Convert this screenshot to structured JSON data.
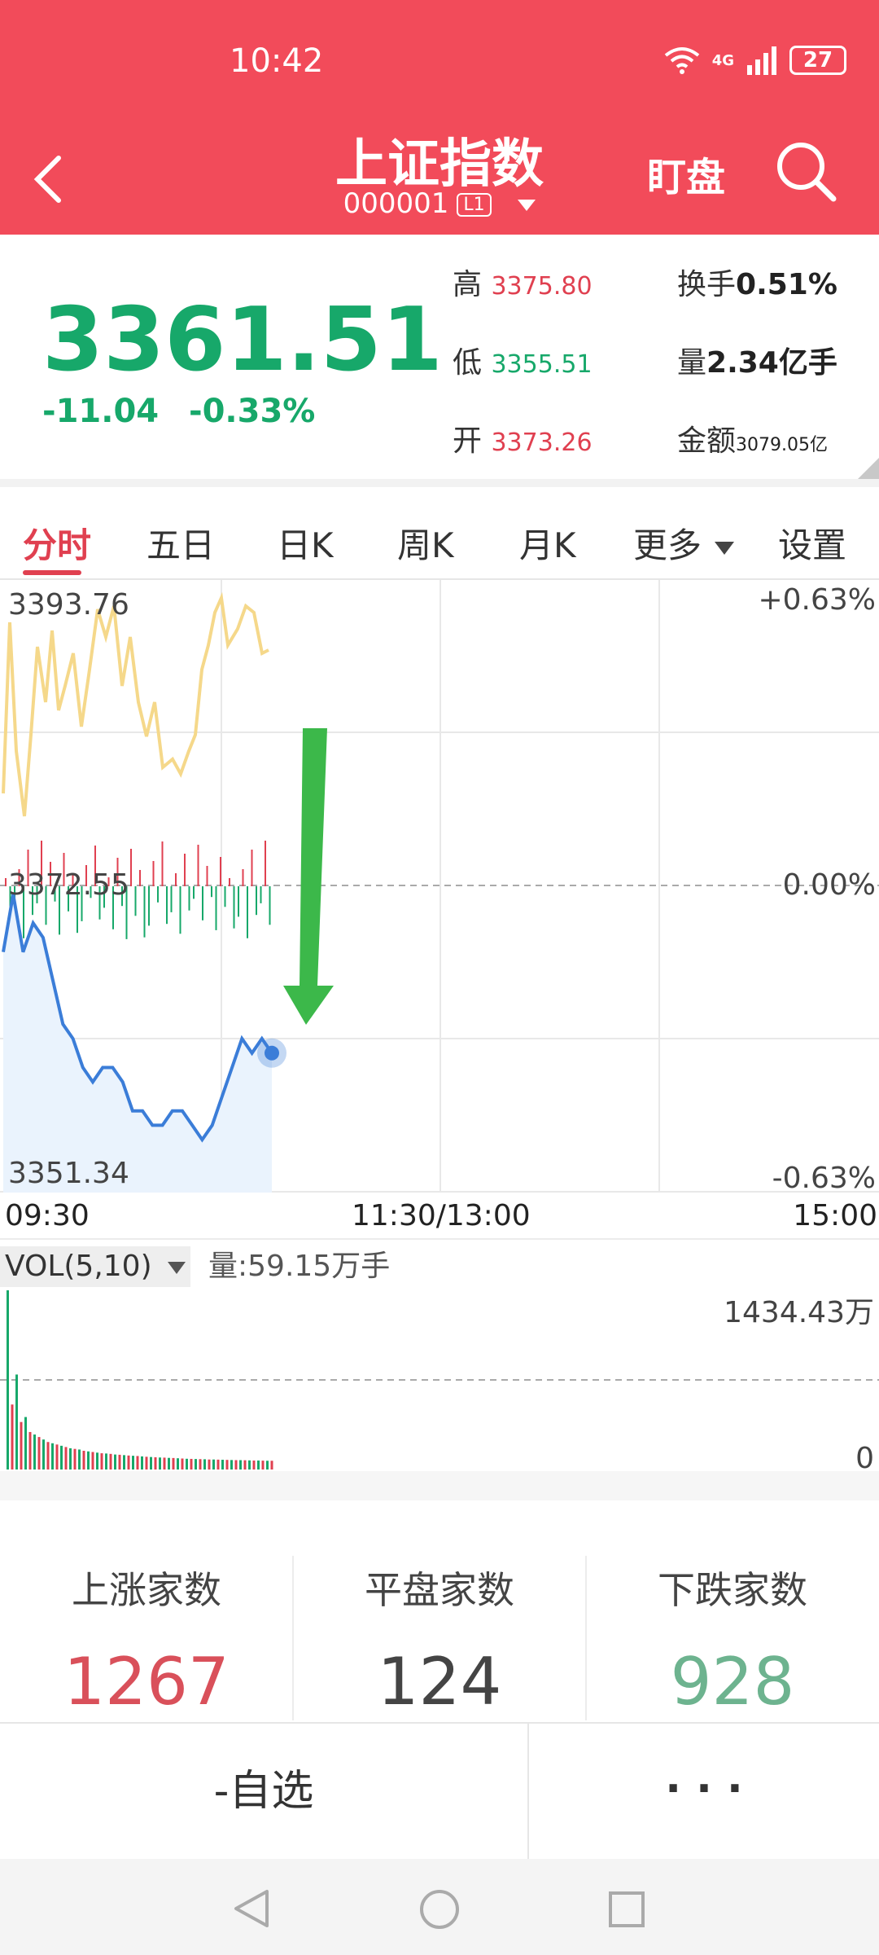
{
  "status": {
    "time": "10:42",
    "network": "4G",
    "battery": "27"
  },
  "header": {
    "title": "上证指数",
    "code": "000001",
    "level_badge": "L1",
    "watch_label": "盯盘"
  },
  "quote": {
    "price": "3361.51",
    "change": "-11.04",
    "change_pct": "-0.33%",
    "high_label": "高",
    "high": "3375.80",
    "low_label": "低",
    "low": "3355.51",
    "open_label": "开",
    "open": "3373.26",
    "turnover_label": "换手",
    "turnover": "0.51%",
    "volume_label": "量",
    "volume": "2.34亿手",
    "amount_label": "金额",
    "amount": "3079.05亿"
  },
  "tabs": [
    {
      "label": "分时",
      "active": true
    },
    {
      "label": "五日"
    },
    {
      "label": "日K"
    },
    {
      "label": "周K"
    },
    {
      "label": "月K"
    },
    {
      "label": "更多"
    },
    {
      "label": "设置"
    }
  ],
  "chart_data": {
    "type": "line",
    "y_left_ticks": [
      "3393.76",
      "3372.55",
      "3351.34"
    ],
    "y_right_ticks": [
      "+0.63%",
      "0.00%",
      "-0.63%"
    ],
    "x_ticks": [
      "09:30",
      "11:30/13:00",
      "15:00"
    ],
    "ylim": [
      3351.34,
      3393.76
    ],
    "prev_close": 3372.55,
    "price_series": [
      3368,
      3372,
      3368,
      3370,
      3369,
      3366,
      3363,
      3362,
      3360,
      3359,
      3360,
      3360,
      3359,
      3357,
      3357,
      3356,
      3356,
      3357,
      3357,
      3356,
      3355,
      3356,
      3358,
      3360,
      3362,
      3361,
      3362,
      3361
    ],
    "volume": {
      "label": "VOL(5,10)",
      "amount_text": "量:59.15万手",
      "max_label": "1434.43万",
      "min_label": "0",
      "values": [
        1434,
        520,
        760,
        380,
        420,
        300,
        280,
        260,
        240,
        220,
        210,
        200,
        190,
        180,
        170,
        165,
        160,
        150,
        145,
        140,
        135,
        130,
        128,
        125,
        120,
        118,
        115,
        112,
        110,
        108,
        105,
        102,
        100,
        98,
        96,
        95,
        93,
        92,
        90,
        88,
        86,
        85,
        84,
        83,
        82,
        80,
        80,
        79,
        78,
        77,
        76,
        75,
        75,
        74,
        73,
        72,
        72,
        71,
        70,
        70
      ]
    }
  },
  "breadth": {
    "up_label": "上涨家数",
    "up": "1267",
    "flat_label": "平盘家数",
    "flat": "124",
    "down_label": "下跌家数",
    "down": "928"
  },
  "bottom": {
    "watchlist": "-自选",
    "more": "· · ·"
  },
  "colors": {
    "header": "#f24b5a",
    "up": "#e04050",
    "down": "#17a86a",
    "price_line": "#3b7dd8",
    "avg_line": "#f5d88a",
    "arrow": "#3cb84a"
  }
}
